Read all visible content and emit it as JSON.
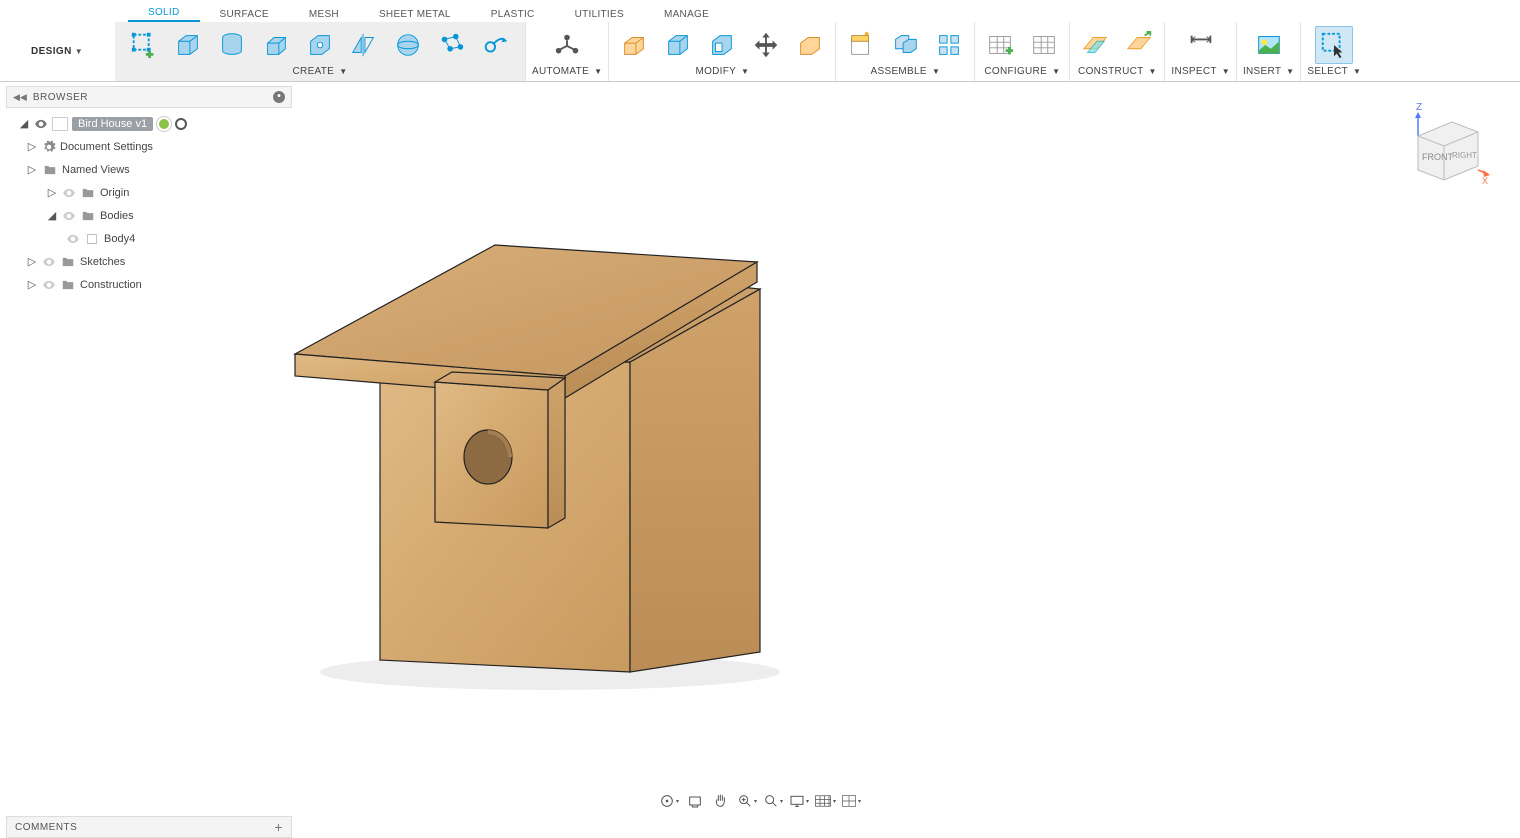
{
  "workspace": {
    "label": "DESIGN"
  },
  "tabs": [
    "SOLID",
    "SURFACE",
    "MESH",
    "SHEET METAL",
    "PLASTIC",
    "UTILITIES",
    "MANAGE"
  ],
  "activeTab": 0,
  "groups": {
    "create": "CREATE",
    "automate": "AUTOMATE",
    "modify": "MODIFY",
    "assemble": "ASSEMBLE",
    "configure": "CONFIGURE",
    "construct": "CONSTRUCT",
    "inspect": "INSPECT",
    "insert": "INSERT",
    "select": "SELECT"
  },
  "browser": {
    "title": "BROWSER",
    "root": "Bird House v1",
    "items": {
      "docSettings": "Document Settings",
      "namedViews": "Named Views",
      "origin": "Origin",
      "bodies": "Bodies",
      "body4": "Body4",
      "sketches": "Sketches",
      "construction": "Construction"
    }
  },
  "viewcube": {
    "front": "FRONT",
    "right": "RIGHT",
    "z": "Z",
    "x": "X"
  },
  "comments": {
    "label": "COMMENTS"
  }
}
